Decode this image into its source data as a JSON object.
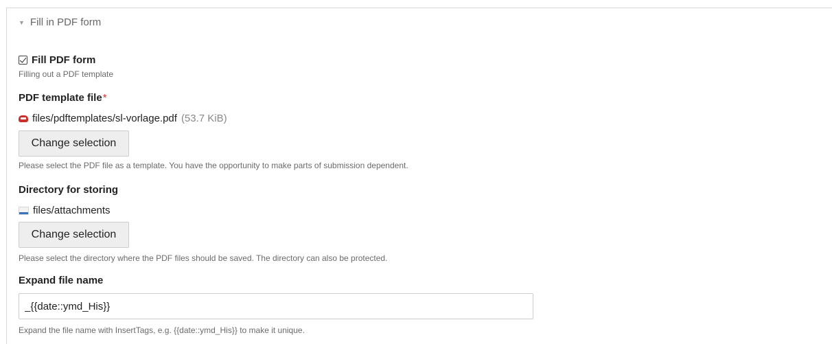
{
  "section": {
    "legend": "Fill in PDF form"
  },
  "fill_pdf": {
    "label": "Fill PDF form",
    "checked": true,
    "help": "Filling out a PDF template"
  },
  "pdf_template": {
    "label": "PDF template file",
    "required_mark": "*",
    "file_path": "files/pdftemplates/sl-vorlage.pdf",
    "file_size": "(53.7 KiB)",
    "button_label": "Change selection",
    "help": "Please select the PDF file as a template. You have the opportunity to make parts of submission dependent."
  },
  "storage_dir": {
    "label": "Directory for storing",
    "path": "files/attachments",
    "button_label": "Change selection",
    "help": "Please select the directory where the PDF files should be saved. The directory can also be protected."
  },
  "file_name": {
    "label": "Expand file name",
    "value": "_{{date::ymd_His}}",
    "help": "Expand the file name with InsertTags, e.g. {{date::ymd_His}} to make it unique."
  },
  "icons": {
    "legend_toggle": "triangle-down-icon",
    "checkbox": "checkbox-checked-icon",
    "pdf": "pdf-file-icon",
    "folder": "folder-icon"
  },
  "colors": {
    "required": "#cc3333",
    "pdf_icon": "#c9302c",
    "folder_icon": "#3b73b9"
  }
}
